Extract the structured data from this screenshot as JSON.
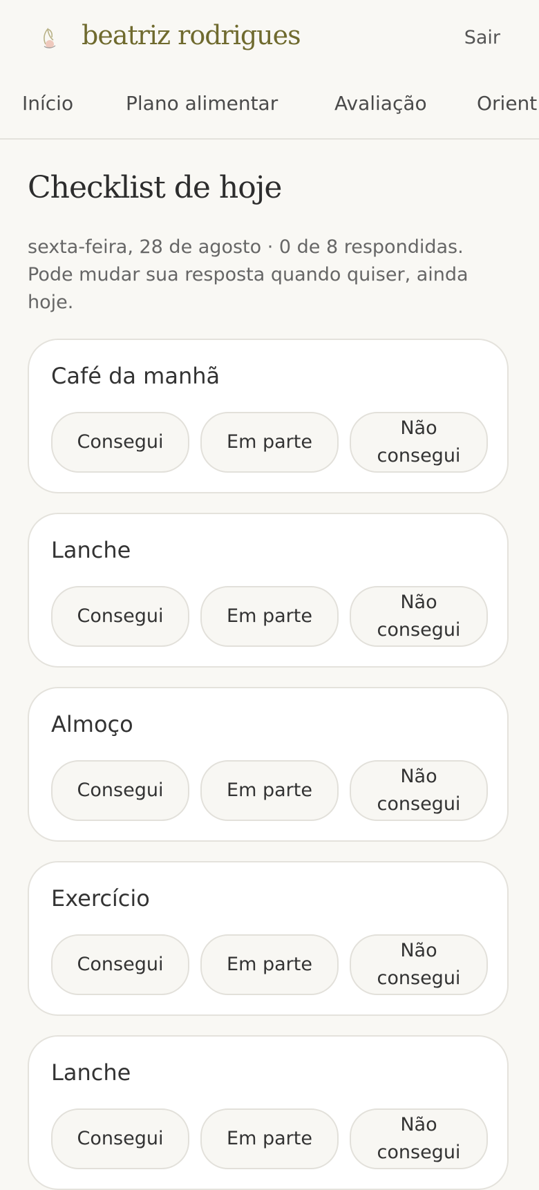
{
  "header": {
    "brand": "beatriz rodrigues",
    "logo_icon": "hand-leaf-icon",
    "logout_label": "Sair",
    "brand_color": "#6f6a2e"
  },
  "nav": {
    "tabs": [
      {
        "label": "Início"
      },
      {
        "label": "Plano alimentar"
      },
      {
        "label": "Avaliação"
      },
      {
        "label": "Orient"
      }
    ]
  },
  "main": {
    "title": "Checklist de hoje",
    "subtitle": "sexta-feira, 28 de agosto · 0 de 8 respondidas. Pode mudar sua resposta quando quiser, ainda hoje.",
    "items": [
      {
        "label": "Café da manhã",
        "options": [
          "Consegui",
          "Em parte",
          "Não consegui"
        ]
      },
      {
        "label": "Lanche",
        "options": [
          "Consegui",
          "Em parte",
          "Não consegui"
        ]
      },
      {
        "label": "Almoço",
        "options": [
          "Consegui",
          "Em parte",
          "Não consegui"
        ]
      },
      {
        "label": "Exercício",
        "options": [
          "Consegui",
          "Em parte",
          "Não consegui"
        ]
      },
      {
        "label": "Lanche",
        "options": [
          "Consegui",
          "Em parte",
          "Não consegui"
        ]
      }
    ]
  }
}
